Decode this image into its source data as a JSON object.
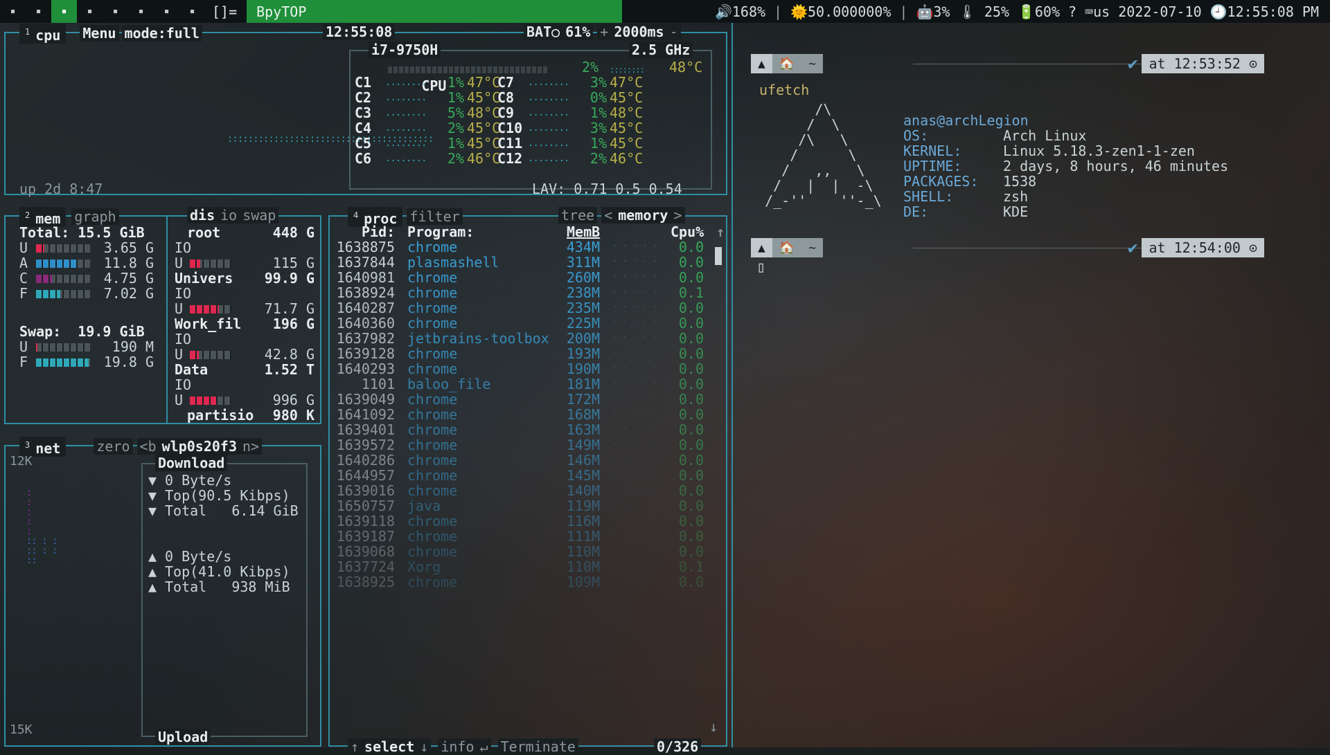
{
  "topbar": {
    "workspaces": [
      "1",
      "2",
      "3",
      "4",
      "5",
      "6",
      "7",
      "8"
    ],
    "active_workspace": 2,
    "layout_symbol": "[]=",
    "window_title": "BpyTOP",
    "volume": "🔊168%",
    "brightness": "🌞50.000000%",
    "cpu": "🤖3%",
    "mem": "🌡 25%",
    "battery": "🔋60% ?",
    "keyboard": "⌨us",
    "date": "2022-07-10",
    "time": "🕘12:55:08 PM",
    "sep": "|"
  },
  "cpu_box": {
    "num": "1",
    "title": "cpu",
    "menu": "Menu",
    "mode": "mode:full",
    "clock": "12:55:08",
    "bat_label": "BAT○",
    "bat_value": "61%",
    "plus": "+",
    "interval": "2000ms",
    "minus": "-",
    "uptime": "up 2d 8:47",
    "cpu_name": "i7-9750H",
    "freq": "2.5 GHz",
    "total_label": "CPU",
    "total_pct": "2%",
    "total_temp": "48°C",
    "cores": [
      {
        "name": "C1",
        "pct": "1%",
        "temp": "47°C"
      },
      {
        "name": "C2",
        "pct": "1%",
        "temp": "45°C"
      },
      {
        "name": "C3",
        "pct": "5%",
        "temp": "48°C"
      },
      {
        "name": "C4",
        "pct": "2%",
        "temp": "45°C"
      },
      {
        "name": "C5",
        "pct": "1%",
        "temp": "45°C"
      },
      {
        "name": "C6",
        "pct": "2%",
        "temp": "46°C"
      },
      {
        "name": "C7",
        "pct": "3%",
        "temp": "47°C"
      },
      {
        "name": "C8",
        "pct": "0%",
        "temp": "45°C"
      },
      {
        "name": "C9",
        "pct": "1%",
        "temp": "48°C"
      },
      {
        "name": "C10",
        "pct": "3%",
        "temp": "45°C"
      },
      {
        "name": "C11",
        "pct": "1%",
        "temp": "45°C"
      },
      {
        "name": "C12",
        "pct": "2%",
        "temp": "46°C"
      }
    ],
    "lav": "LAV: 0.71 0.5 0.54"
  },
  "mem_box": {
    "num": "2",
    "title": "mem",
    "graph": "graph",
    "total": "Total: 15.5 GiB",
    "rows": [
      {
        "k": "U",
        "v": "3.65 G",
        "fill": 0.15,
        "color": "#e02850"
      },
      {
        "k": "A",
        "v": "11.8 G",
        "fill": 0.75,
        "color": "#2f8fc8"
      },
      {
        "k": "C",
        "v": "4.75 G",
        "fill": 0.3,
        "color": "#8a2a7a"
      },
      {
        "k": "F",
        "v": "7.02 G",
        "fill": 0.45,
        "color": "#2fa8b8"
      }
    ],
    "swap": "Swap:  19.9 GiB",
    "swap_rows": [
      {
        "k": "U",
        "v": "190 M",
        "fill": 0.02,
        "color": "#e02850"
      },
      {
        "k": "F",
        "v": "19.8 G",
        "fill": 0.98,
        "color": "#2fa8b8"
      }
    ]
  },
  "disk_box": {
    "title": "dis",
    "io": "io",
    "swap": "swap",
    "disks": [
      {
        "name": "root",
        "size": "448 G",
        "io": "IO",
        "used": "115 G",
        "fill": 0.25
      },
      {
        "name": "Univers",
        "size": "99.9 G",
        "io": "IO",
        "used": "71.7 G",
        "fill": 0.7
      },
      {
        "name": "Work_fil",
        "size": "196 G",
        "io": "IO",
        "used": "42.8 G",
        "fill": 0.22
      },
      {
        "name": "Data",
        "size": "1.52 T",
        "io": "IO",
        "used": "996 G",
        "fill": 0.65
      }
    ],
    "last": {
      "name": "partisio",
      "size": "980 K"
    }
  },
  "net_box": {
    "num": "3",
    "title": "net",
    "zero": "zero",
    "prev": "<b",
    "iface": "wlp0s20f3",
    "next": "n>",
    "scale_top": "12K",
    "scale_bottom": "15K",
    "download_label": "Download",
    "download": [
      {
        "arrow": "▼",
        "text": "0 Byte/s"
      },
      {
        "arrow": "▼",
        "text": "Top(90.5 Kibps)"
      },
      {
        "arrow": "▼",
        "text": "Total   6.14 GiB"
      }
    ],
    "upload": [
      {
        "arrow": "▲",
        "text": "0 Byte/s"
      },
      {
        "arrow": "▲",
        "text": "Top(41.0 Kibps)"
      },
      {
        "arrow": "▲",
        "text": "Total   938 MiB"
      }
    ],
    "upload_label": "Upload"
  },
  "proc_box": {
    "num": "4",
    "title": "proc",
    "filter": "filter",
    "tree": "tree",
    "sort_prev": "<",
    "sort": "memory",
    "sort_next": ">",
    "col_pid": "Pid:",
    "col_program": "Program:",
    "col_mem": "MemB",
    "col_cpu": "Cpu%",
    "scroll_up": "↑",
    "scroll_down": "↓",
    "rows": [
      {
        "pid": "1638875",
        "prog": "chrome",
        "mem": "434M",
        "cpu": "0.0"
      },
      {
        "pid": "1637844",
        "prog": "plasmashell",
        "mem": "311M",
        "cpu": "0.0"
      },
      {
        "pid": "1640981",
        "prog": "chrome",
        "mem": "260M",
        "cpu": "0.0"
      },
      {
        "pid": "1638924",
        "prog": "chrome",
        "mem": "238M",
        "cpu": "0.1"
      },
      {
        "pid": "1640287",
        "prog": "chrome",
        "mem": "235M",
        "cpu": "0.0"
      },
      {
        "pid": "1640360",
        "prog": "chrome",
        "mem": "225M",
        "cpu": "0.0"
      },
      {
        "pid": "1637982",
        "prog": "jetbrains-toolbox",
        "mem": "200M",
        "cpu": "0.0"
      },
      {
        "pid": "1639128",
        "prog": "chrome",
        "mem": "193M",
        "cpu": "0.0"
      },
      {
        "pid": "1640293",
        "prog": "chrome",
        "mem": "190M",
        "cpu": "0.0"
      },
      {
        "pid": "1101",
        "prog": "baloo_file",
        "mem": "181M",
        "cpu": "0.0"
      },
      {
        "pid": "1639049",
        "prog": "chrome",
        "mem": "172M",
        "cpu": "0.0"
      },
      {
        "pid": "1641092",
        "prog": "chrome",
        "mem": "168M",
        "cpu": "0.0"
      },
      {
        "pid": "1639401",
        "prog": "chrome",
        "mem": "163M",
        "cpu": "0.0"
      },
      {
        "pid": "1639572",
        "prog": "chrome",
        "mem": "149M",
        "cpu": "0.0"
      },
      {
        "pid": "1640286",
        "prog": "chrome",
        "mem": "146M",
        "cpu": "0.0"
      },
      {
        "pid": "1644957",
        "prog": "chrome",
        "mem": "145M",
        "cpu": "0.0"
      },
      {
        "pid": "1639016",
        "prog": "chrome",
        "mem": "140M",
        "cpu": "0.0"
      },
      {
        "pid": "1650757",
        "prog": "java",
        "mem": "119M",
        "cpu": "0.0"
      },
      {
        "pid": "1639118",
        "prog": "chrome",
        "mem": "116M",
        "cpu": "0.0"
      },
      {
        "pid": "1639187",
        "prog": "chrome",
        "mem": "111M",
        "cpu": "0.0"
      },
      {
        "pid": "1639068",
        "prog": "chrome",
        "mem": "110M",
        "cpu": "0.0"
      },
      {
        "pid": "1637724",
        "prog": "Xorg",
        "mem": "110M",
        "cpu": "0.1"
      },
      {
        "pid": "1638925",
        "prog": "chrome",
        "mem": "109M",
        "cpu": "0.0"
      }
    ],
    "footer_up": "↑",
    "footer_select": "select",
    "footer_down": "↓",
    "footer_info": "info",
    "footer_enter": "↵",
    "footer_terminate": "Terminate",
    "count": "0/326"
  },
  "terminal": {
    "prompt1": {
      "home": "🏠",
      "dir": "~",
      "time": "at 12:53:52"
    },
    "command": "ufetch",
    "fetch_user": "anas@archLegion",
    "fetch": [
      {
        "k": "OS:",
        "v": "Arch Linux"
      },
      {
        "k": "KERNEL:",
        "v": "Linux 5.18.3-zen1-1-zen"
      },
      {
        "k": "UPTIME:",
        "v": "2 days, 8 hours, 46 minutes"
      },
      {
        "k": "PACKAGES:",
        "v": "1538"
      },
      {
        "k": "SHELL:",
        "v": "zsh"
      },
      {
        "k": "DE:",
        "v": "KDE"
      }
    ],
    "prompt2": {
      "home": "🏠",
      "dir": "~",
      "time": "at 12:54:00"
    },
    "cursor": "▯"
  },
  "colors": {
    "border": "#2f8fa5",
    "accent_green": "#1f8f3a",
    "proc_blue": "#3a9fd6",
    "hot": "#e02850"
  }
}
